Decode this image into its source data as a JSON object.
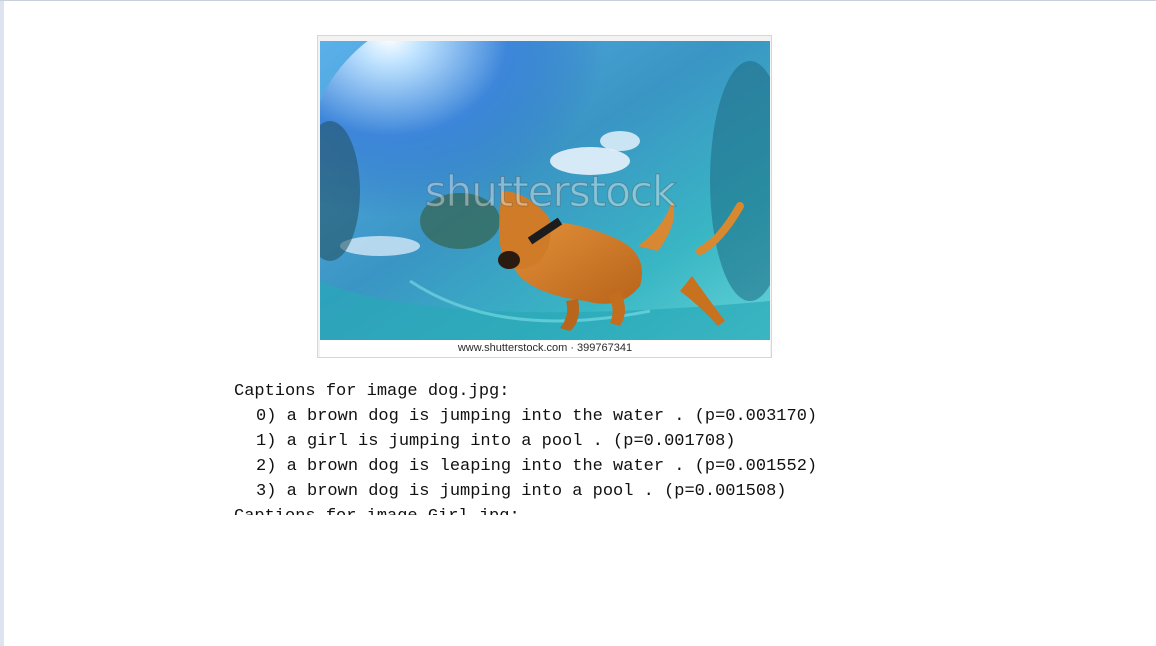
{
  "image": {
    "watermark_text": "shutterstock",
    "footer_text": "www.shutterstock.com · 399767341",
    "subject_icon": "dog-underwater-photo"
  },
  "output": {
    "header": "Captions for image dog.jpg:",
    "captions": [
      "0) a brown dog is jumping into the water . (p=0.003170)",
      "1) a girl is jumping into a pool . (p=0.001708)",
      "2) a brown dog is leaping into the water . (p=0.001552)",
      "3) a brown dog is jumping into a pool . (p=0.001508)"
    ],
    "next_header_partial": "Captions for image Girl.jpg:"
  },
  "colors": {
    "water_deep": "#1f7fa0",
    "water_light": "#52c6d6",
    "sky": "#2f7fd8",
    "dog": "#c9741f"
  }
}
